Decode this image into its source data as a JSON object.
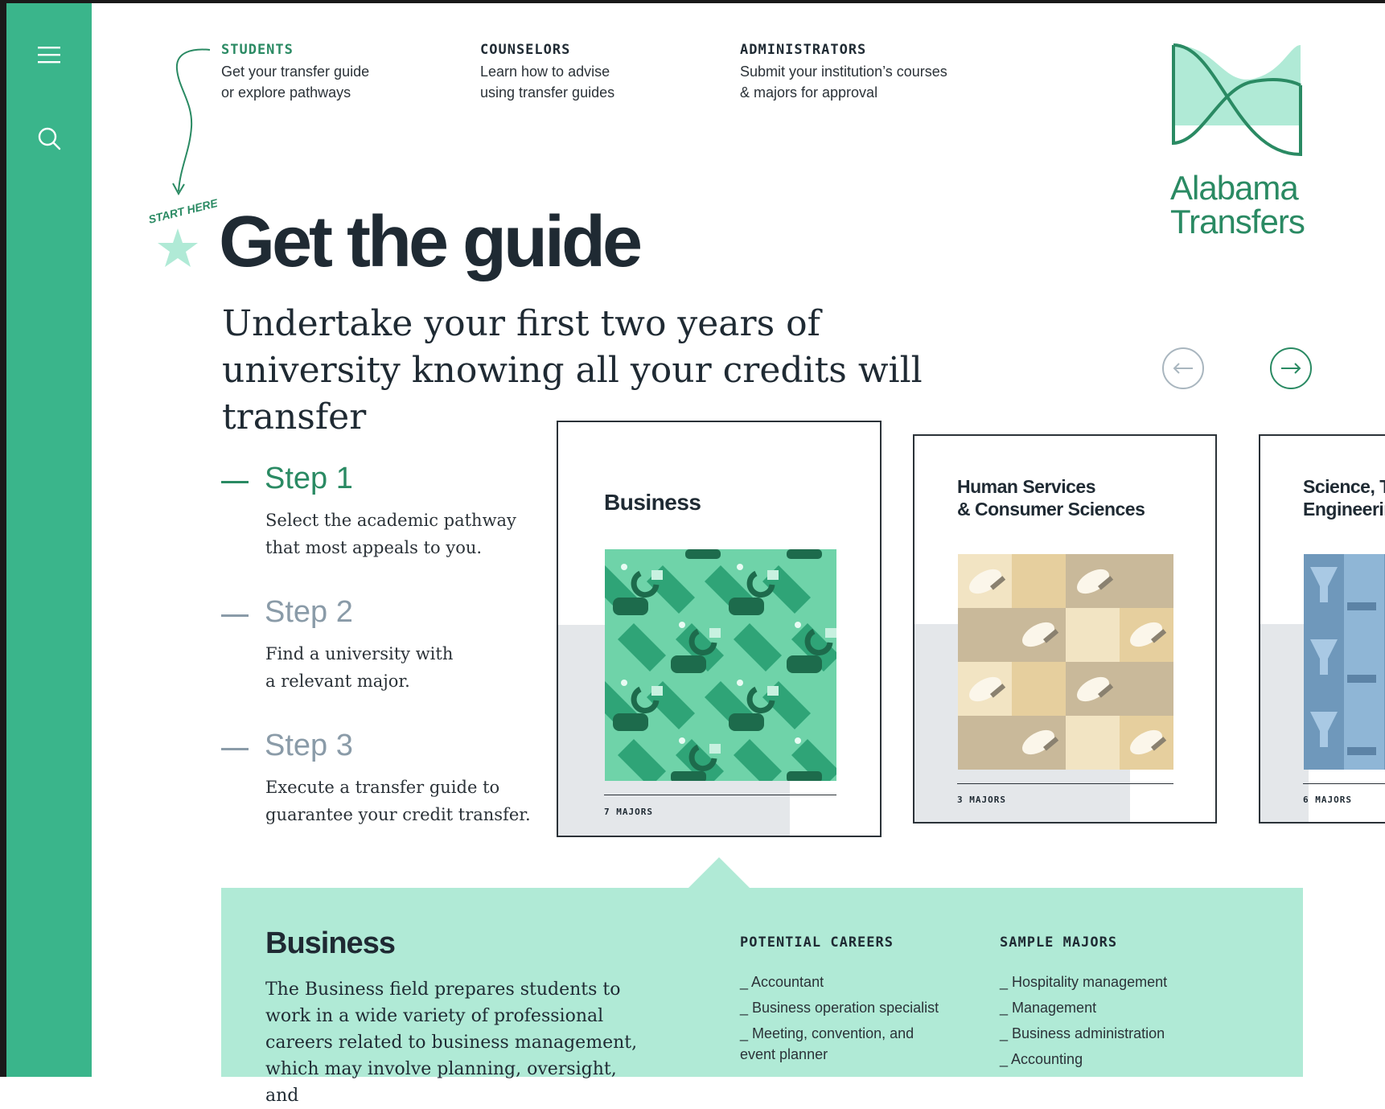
{
  "colors": {
    "brand_green": "#3ab58b",
    "dark_green": "#2a8a63",
    "mint": "#b0ead6",
    "ink": "#1f2a33",
    "muted_step": "#8a9ba8"
  },
  "sidebar": {
    "menu_icon": "hamburger-menu-icon",
    "search_icon": "search-icon"
  },
  "nav": [
    {
      "label": "STUDENTS",
      "desc": "Get your transfer guide\nor explore pathways"
    },
    {
      "label": "COUNSELORS",
      "desc": "Learn how to advise\nusing transfer guides"
    },
    {
      "label": "ADMINISTRATORS",
      "desc": "Submit your institution’s courses\n& majors for approval"
    }
  ],
  "annotation": {
    "start_here": "START HERE!"
  },
  "logo": {
    "text": "Alabama\nTransfers"
  },
  "hero": {
    "title": "Get the guide",
    "subtitle": "Undertake your first two years of university knowing all your credits will transfer"
  },
  "carousel": {
    "prev_icon": "arrow-left-icon",
    "next_icon": "arrow-right-icon"
  },
  "steps": [
    {
      "title": "Step 1",
      "body": "Select the academic pathway\nthat most appeals to you.",
      "active": true
    },
    {
      "title": "Step 2",
      "body": "Find a university with\na relevant major.",
      "active": false
    },
    {
      "title": "Step 3",
      "body": "Execute a transfer guide to\nguarantee your credit transfer.",
      "active": false
    }
  ],
  "cards": [
    {
      "title": "Business",
      "majors": "7 MAJORS"
    },
    {
      "title": "Human Services\n& Consumer Sciences",
      "majors": "3 MAJORS"
    },
    {
      "title": "Science, Technology\nEngineering",
      "majors": "6 MAJORS"
    }
  ],
  "detail": {
    "title": "Business",
    "description": "The Business field prepares students to work in a wide variety of professional careers related to business management, which may involve planning, oversight, and",
    "careers_heading": "POTENTIAL CAREERS",
    "careers": [
      "_ Accountant",
      "_ Business operation specialist",
      "_ Meeting, convention, and\n   event planner"
    ],
    "majors_heading": "SAMPLE MAJORS",
    "majors": [
      "_ Hospitality management",
      "_ Management",
      "_ Business administration",
      "_ Accounting"
    ]
  }
}
